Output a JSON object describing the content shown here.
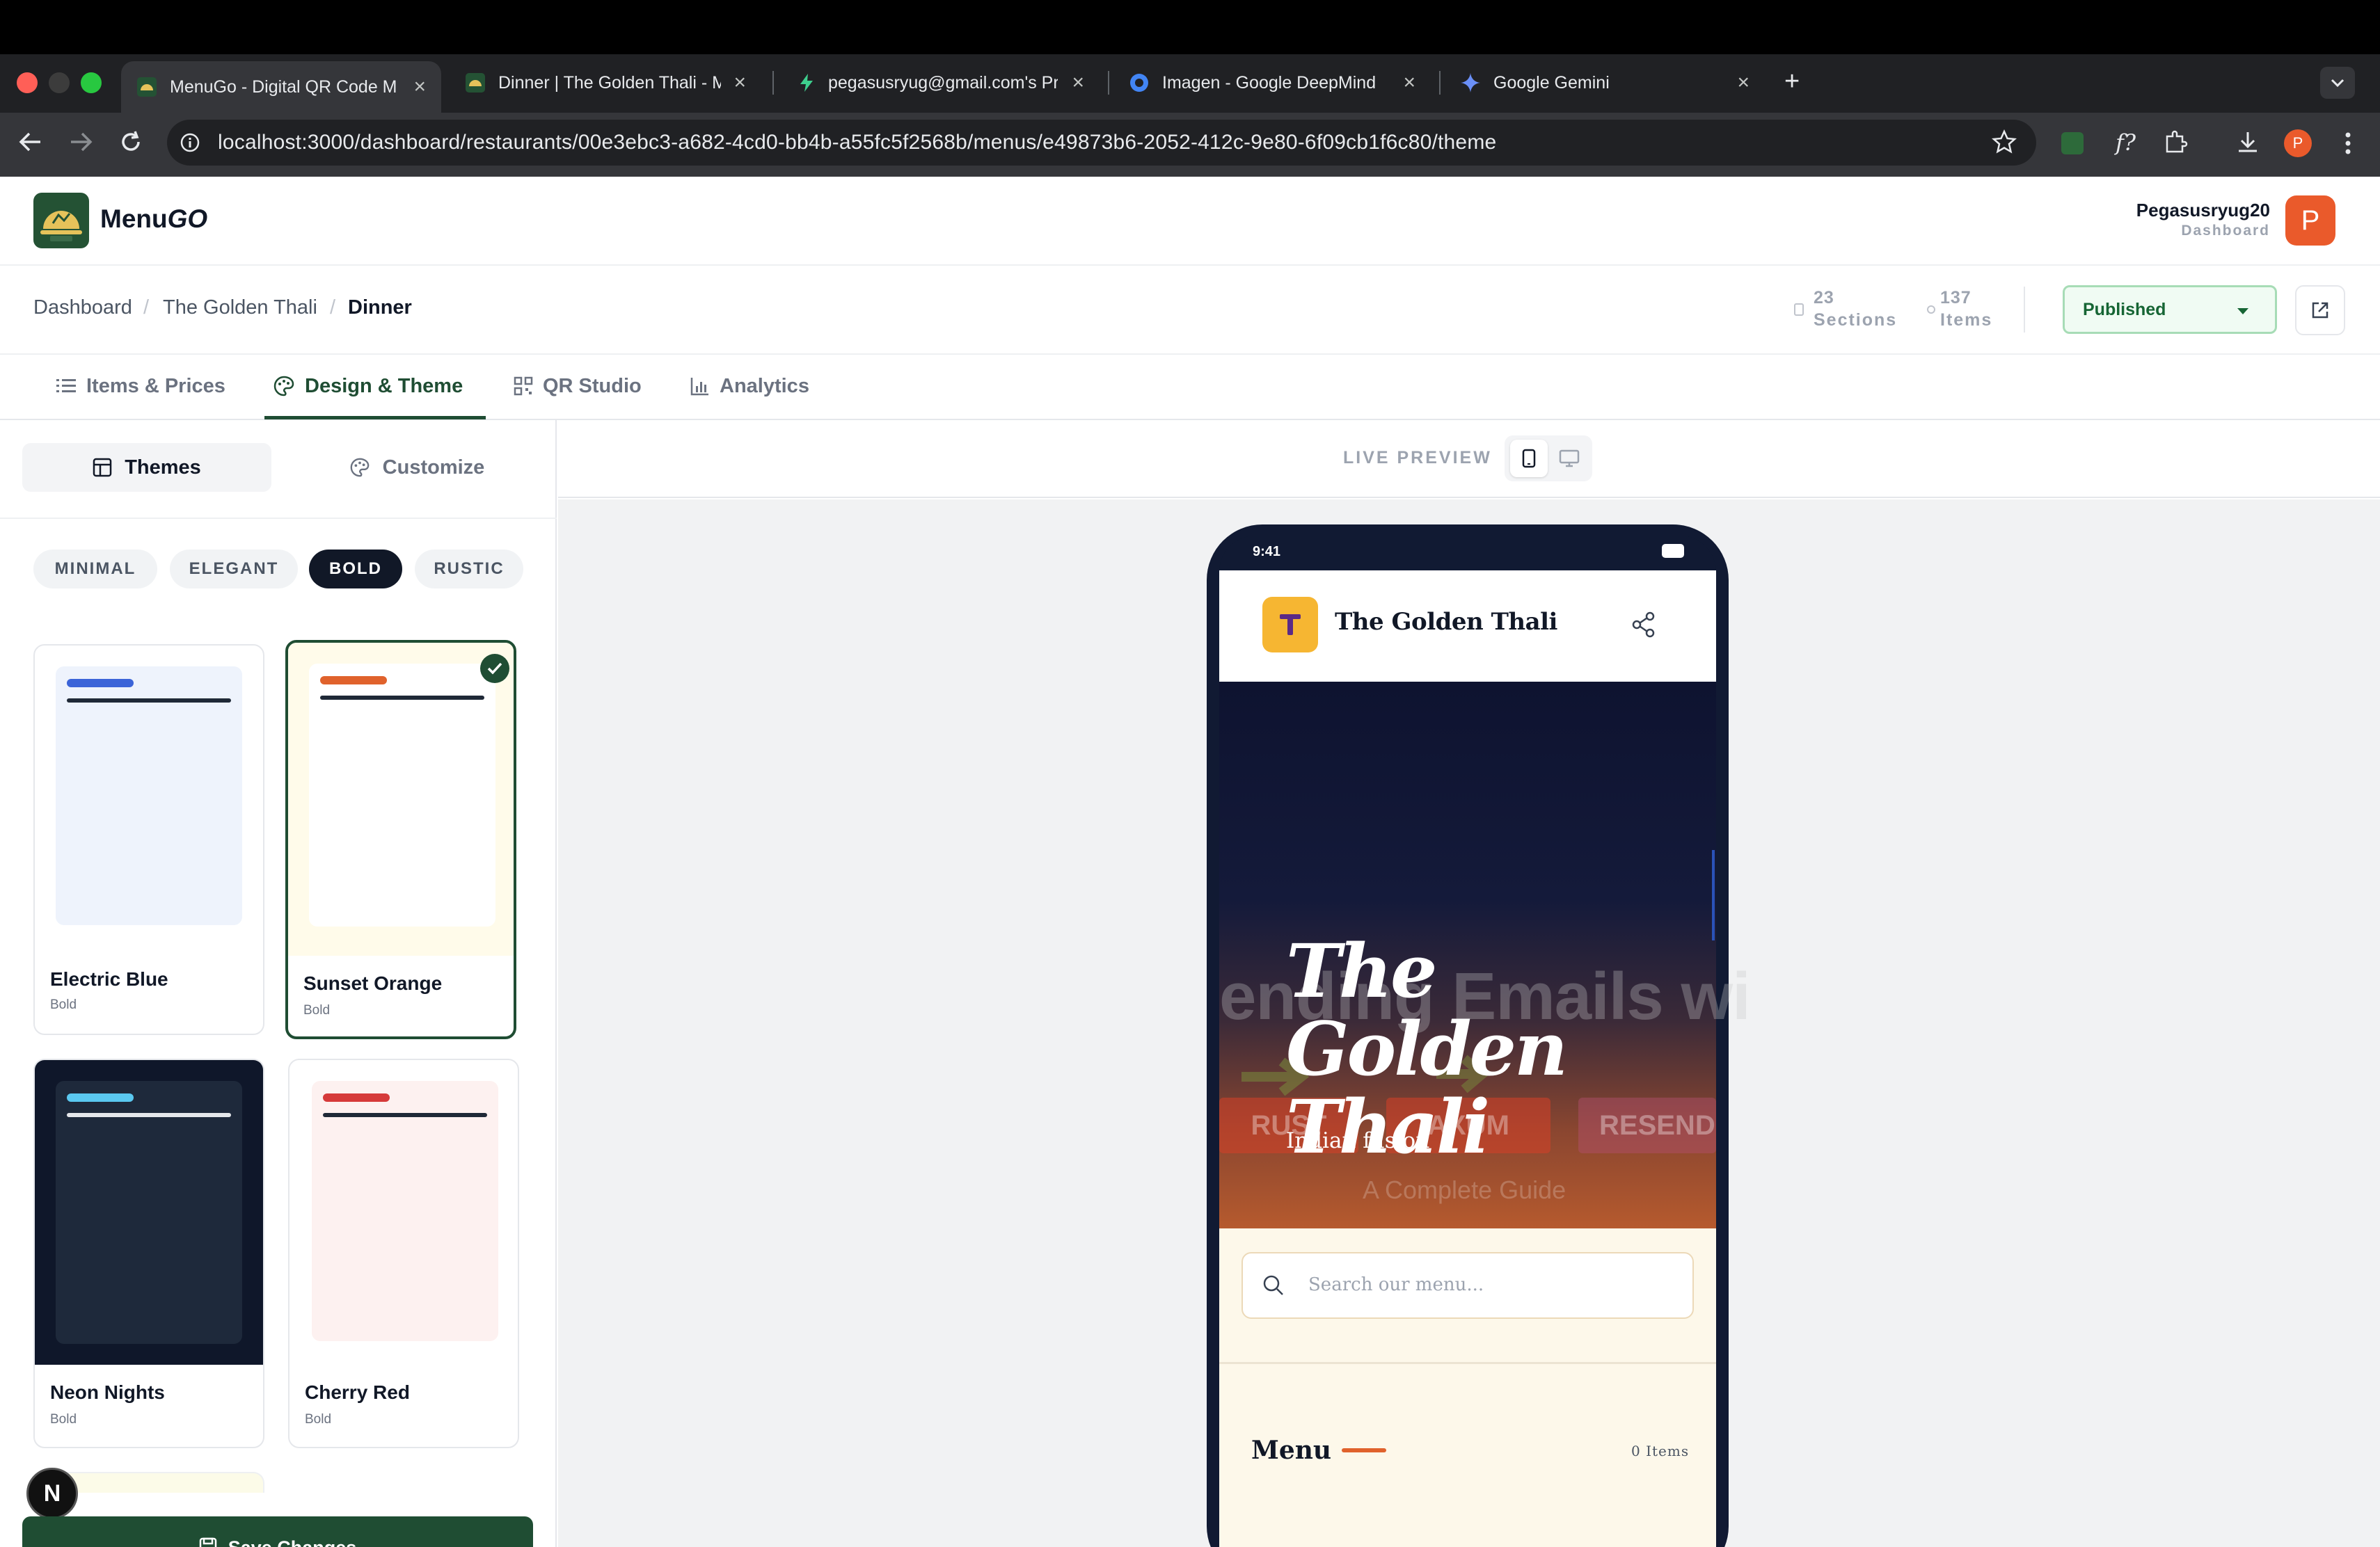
{
  "browser": {
    "tabs": [
      {
        "title": "MenuGo - Digital QR Code M",
        "icon": "menugo-favicon",
        "active": true
      },
      {
        "title": "Dinner | The Golden Thali - M",
        "icon": "menugo-favicon",
        "active": false
      },
      {
        "title": "pegasusryug@gmail.com's Pr",
        "icon": "bolt-icon",
        "active": false
      },
      {
        "title": "Imagen - Google DeepMind",
        "icon": "deepmind-icon",
        "active": false
      },
      {
        "title": "Google Gemini",
        "icon": "gemini-icon",
        "active": false
      }
    ],
    "url": "localhost:3000/dashboard/restaurants/00e3ebc3-a682-4cd0-bb4b-a55fc5f2568b/menus/e49873b6-2052-412c-9e80-6f09cb1f6c80/theme",
    "profile_initial": "P"
  },
  "header": {
    "brand_prefix": "Menu",
    "brand_suffix": "GO",
    "username": "Pegasusryug20",
    "role": "Dashboard",
    "avatar_initial": "P"
  },
  "breadcrumb": [
    "Dashboard",
    "The Golden Thali",
    "Dinner"
  ],
  "stats": {
    "sections_count": "23",
    "sections_label": "Sections",
    "items_count": "137",
    "items_label": "Items"
  },
  "status_select": "Published",
  "nav_tabs": [
    "Items & Prices",
    "Design & Theme",
    "QR Studio",
    "Analytics"
  ],
  "panel": {
    "segments": [
      "Themes",
      "Customize"
    ],
    "filters": [
      "MINIMAL",
      "ELEGANT",
      "BOLD",
      "RUSTIC"
    ],
    "themes": [
      {
        "name": "Electric Blue",
        "category": "Bold",
        "accent": "#3b64d8",
        "bg": "#eef3fc"
      },
      {
        "name": "Sunset Orange",
        "category": "Bold",
        "accent": "#e0622c",
        "bg": "#fffdf3",
        "selected": true
      },
      {
        "name": "Neon Nights",
        "category": "Bold",
        "accent": "#5ac8f0",
        "bg": "#1e293b"
      },
      {
        "name": "Cherry Red",
        "category": "Bold",
        "accent": "#d63a3a",
        "bg": "#fdf1f0"
      }
    ],
    "dev_badge": "N",
    "save_label": "Save Changes"
  },
  "preview": {
    "label": "LIVE PREVIEW",
    "phone": {
      "time": "9:41",
      "restaurant_name": "The Golden Thali",
      "logo_letter": "T",
      "hero_title": "The Golden Thali",
      "hero_subtitle": "Indian fusion",
      "hero_bg_text": "ending Emails wi",
      "hero_bg_chips": [
        "RUST",
        "AXUM",
        "RESEND"
      ],
      "hero_bg_caption": "A Complete Guide",
      "search_placeholder": "Search our menu...",
      "menu_heading": "Menu",
      "items_count": "0 Items"
    }
  },
  "colors": {
    "brand_green": "#1f4d33",
    "accent_orange": "#e0622c",
    "avatar": "#ea5a2b"
  }
}
